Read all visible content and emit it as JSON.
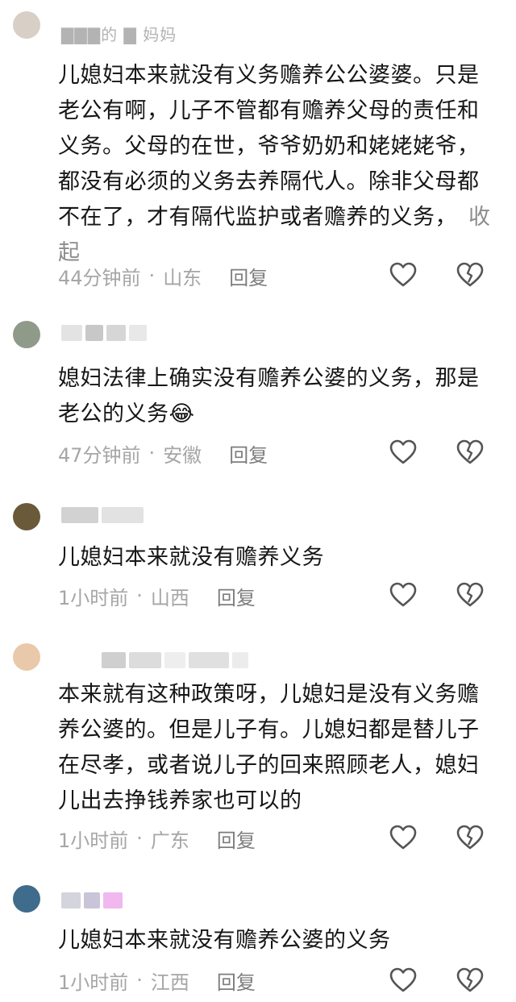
{
  "comments": [
    {
      "username": "▇▇▇的 ▇ 妈妈",
      "avatar_color": "#d8cfc6",
      "text": "儿媳妇本来就没有义务赡养公公婆婆。只是老公有啊，儿子不管都有赡养父母的责任和义务。父母的在世，爷爷奶奶和姥姥姥爷，都没有必须的义务去养隔代人。除非父母都不在了，才有隔代监护或者赡养的义务，",
      "collapse_label": "收起",
      "time": "44分钟前",
      "location": "山东",
      "reply_label": "回复",
      "like_icon": "heart-outline-icon",
      "dislike_icon": "broken-heart-icon"
    },
    {
      "username": "",
      "avatar_color": "#8f9a88",
      "text": "媳妇法律上确实没有赡养公婆的义务，那是老公的义务😂",
      "time": "47分钟前",
      "location": "安徽",
      "reply_label": "回复",
      "like_icon": "heart-outline-icon",
      "dislike_icon": "broken-heart-icon"
    },
    {
      "username": "",
      "avatar_color": "#6b5a3a",
      "text": "儿媳妇本来就没有赡养义务",
      "time": "1小时前",
      "location": "山西",
      "reply_label": "回复",
      "like_icon": "heart-outline-icon",
      "dislike_icon": "broken-heart-icon"
    },
    {
      "username": "",
      "avatar_color": "#e9c9a9",
      "text": "本来就有这种政策呀，儿媳妇是没有义务赡养公婆的。但是儿子有。儿媳妇都是替儿子在尽孝，或者说儿子的回来照顾老人，媳妇儿出去挣钱养家也可以的",
      "time": "1小时前",
      "location": "广东",
      "reply_label": "回复",
      "like_icon": "heart-outline-icon",
      "dislike_icon": "broken-heart-icon"
    },
    {
      "username": "",
      "avatar_color": "#3f6b8c",
      "text": "儿媳妇本来就没有赡养公婆的义务",
      "time": "1小时前",
      "location": "江西",
      "reply_label": "回复",
      "like_icon": "heart-outline-icon",
      "dislike_icon": "broken-heart-icon"
    }
  ],
  "colors": {
    "text": "#161616",
    "meta": "#a6a6a6",
    "reply": "#7d7d7d",
    "icon": "#555555"
  }
}
